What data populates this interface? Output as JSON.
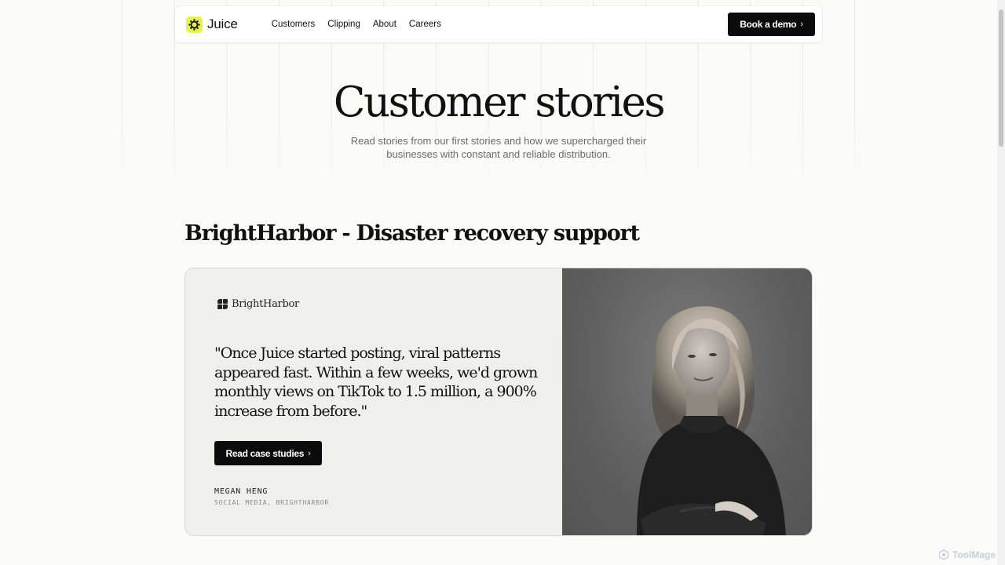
{
  "nav": {
    "logo_text": "Juice",
    "links": [
      "Customers",
      "Clipping",
      "About",
      "Careers"
    ],
    "cta_label": "Book a demo"
  },
  "hero": {
    "title": "Customer stories",
    "subtitle": "Read stories from our first stories and how we supercharged their businesses with constant and reliable distribution."
  },
  "story": {
    "section_title": "BrightHarbor - Disaster recovery support",
    "brand_name": "BrightHarbor",
    "quote": "\"Once Juice started posting, viral patterns appeared fast. Within a few weeks, we'd grown monthly views on TikTok to 1.5 million, a 900% increase from before.\"",
    "button_label": "Read case studies",
    "person_name": "MEGAN HENG",
    "person_role": "SOCIAL MEDIA, BRIGHTHARBOR"
  },
  "watermark": "ToolMage",
  "colors": {
    "accent": "#e7f34a",
    "button_bg": "#0b0b0b",
    "card_bg": "#efefec",
    "page_bg": "#fafaf9"
  },
  "icons": {
    "logo": "juice-logo-icon",
    "chevron": "chevron-right-icon",
    "brand": "brightharbor-logo-icon"
  }
}
